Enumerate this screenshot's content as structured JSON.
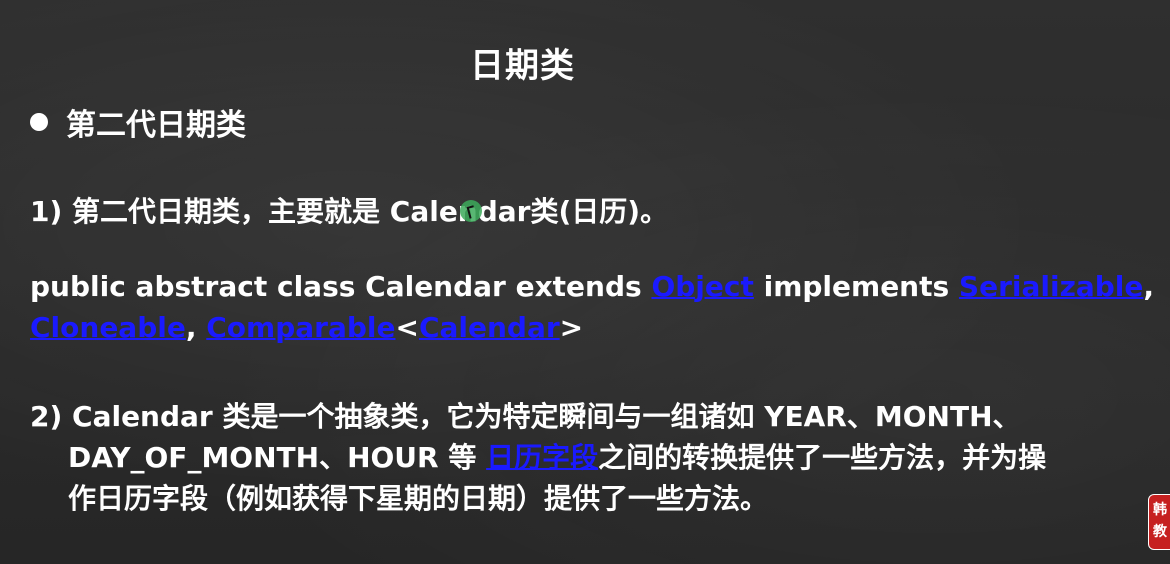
{
  "slide": {
    "title": "日期类",
    "bullet": "第二代日期类",
    "point1": "1) 第二代日期类，主要就是 Calendar类(日历)。",
    "decl": {
      "part1": "public abstract class Calendar extends ",
      "link_object": "Object",
      "part2": " implements ",
      "link_serializable": "Serializable",
      "comma1": ",",
      "link_cloneable": "Cloneable",
      "comma2": ", ",
      "link_comparable": "Comparable",
      "lt": "<",
      "link_calendar": "Calendar",
      "gt": ">"
    },
    "point2": {
      "line1": "2) Calendar 类是一个抽象类，它为特定瞬间与一组诸如 YEAR、MONTH、",
      "line2_a": "DAY_OF_MONTH、HOUR 等 ",
      "line2_link": "日历字段",
      "line2_b": "之间的转换提供了一些方法，并为操",
      "line3": "作日历字段（例如获得下星期的日期）提供了一些方法。"
    }
  },
  "badge": {
    "line1": "韩",
    "line2": "教"
  },
  "colors": {
    "background": "#2b2b2b",
    "text": "#ffffff",
    "link": "#1a1aff",
    "badge": "#c62020"
  }
}
